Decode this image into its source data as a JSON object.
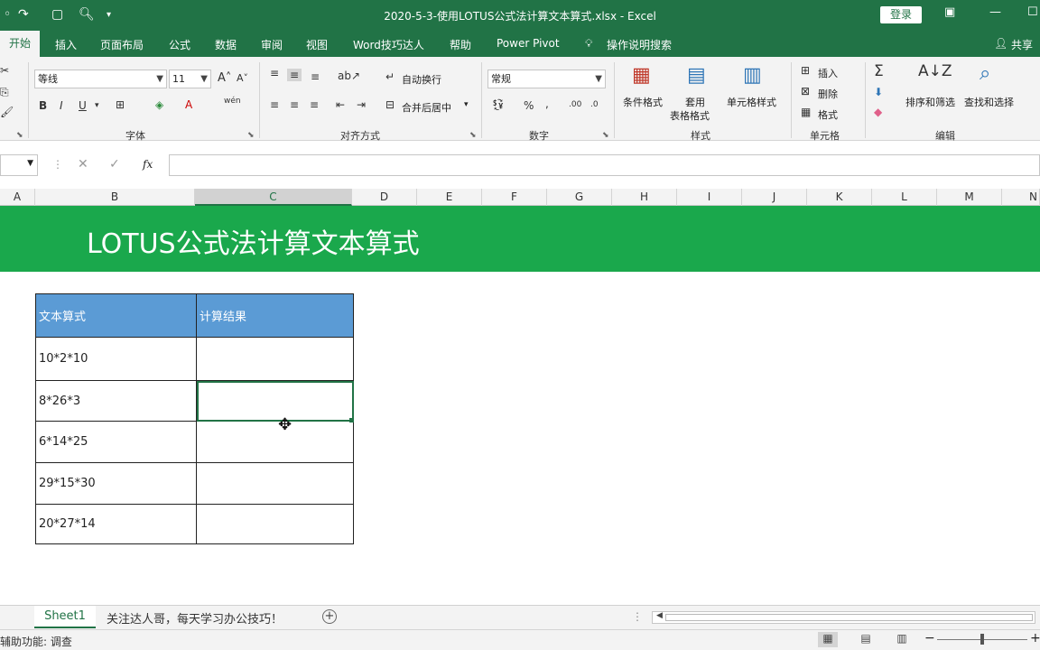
{
  "window": {
    "title": "2020-5-3-使用LOTUS公式法计算文本算式.xlsx  -  Excel",
    "login_label": "登录",
    "share_label": "共享"
  },
  "ribbon_tabs": [
    "开始",
    "插入",
    "页面布局",
    "公式",
    "数据",
    "审阅",
    "视图",
    "Word技巧达人",
    "帮助",
    "Power Pivot",
    "操作说明搜索"
  ],
  "ribbon": {
    "font_name": "等线",
    "font_size": "11",
    "wrap_text": "自动换行",
    "merge_center": "合并后居中",
    "number_format": "常规",
    "conditional_format": "条件格式",
    "format_as_table_1": "套用",
    "format_as_table_2": "表格格式",
    "cell_styles": "单元格样式",
    "insert": "插入",
    "delete": "删除",
    "format": "格式",
    "sort_filter": "排序和筛选",
    "find_select": "查找和选择",
    "groups": {
      "font": "字体",
      "alignment": "对齐方式",
      "number": "数字",
      "styles": "样式",
      "cells": "单元格",
      "editing": "编辑"
    }
  },
  "formula_bar": {
    "fx": "fx",
    "content": ""
  },
  "columns": [
    "A",
    "B",
    "C",
    "D",
    "E",
    "F",
    "G",
    "H",
    "I",
    "J",
    "K",
    "L",
    "M",
    "N"
  ],
  "banner_title": "LOTUS公式法计算文本算式",
  "table": {
    "headers": [
      "文本算式",
      "计算结果"
    ],
    "rows": [
      [
        "10*2*10",
        ""
      ],
      [
        "8*26*3",
        ""
      ],
      [
        "6*14*25",
        ""
      ],
      [
        "29*15*30",
        ""
      ],
      [
        "20*27*14",
        ""
      ]
    ]
  },
  "sheets": [
    "Sheet1",
    "关注达人哥，每天学习办公技巧！"
  ],
  "status": {
    "text": "辅助功能: 调查"
  },
  "colors": {
    "excel_green": "#217346",
    "banner_green": "#1aa84c",
    "header_blue": "#5b9bd5"
  }
}
